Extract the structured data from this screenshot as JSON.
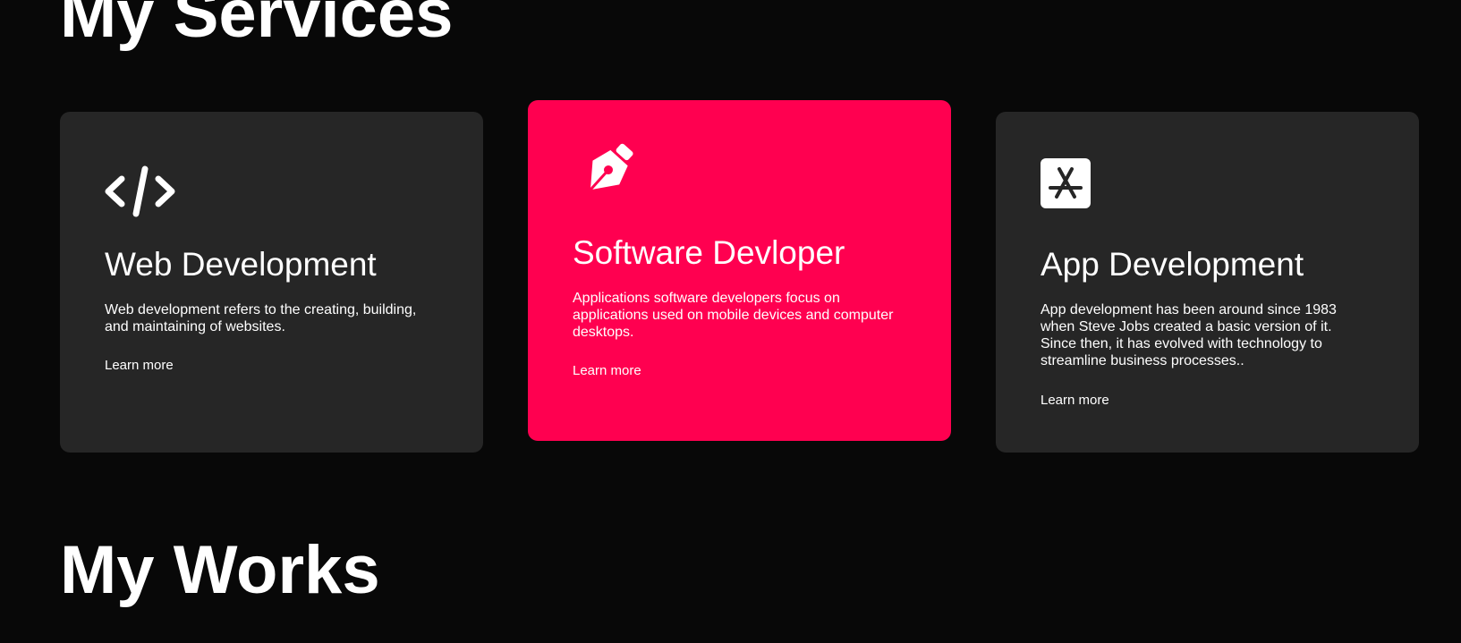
{
  "sections": {
    "services_title": "My Services",
    "works_title": "My Works"
  },
  "accent_color": "#ff0050",
  "cards": [
    {
      "icon": "code-icon",
      "title": "Web Development",
      "description": "Web development refers to the creating, building, and maintaining of websites.",
      "link": "Learn more",
      "highlighted": false
    },
    {
      "icon": "pen-nib-icon",
      "title": "Software Devloper",
      "description": "Applications software developers focus on applications used on mobile devices and computer desktops.",
      "link": "Learn more",
      "highlighted": true
    },
    {
      "icon": "app-store-icon",
      "title": "App Development",
      "description": "App development has been around since 1983 when Steve Jobs created a basic version of it. Since then, it has evolved with technology to streamline business processes..",
      "link": "Learn more",
      "highlighted": false
    }
  ]
}
